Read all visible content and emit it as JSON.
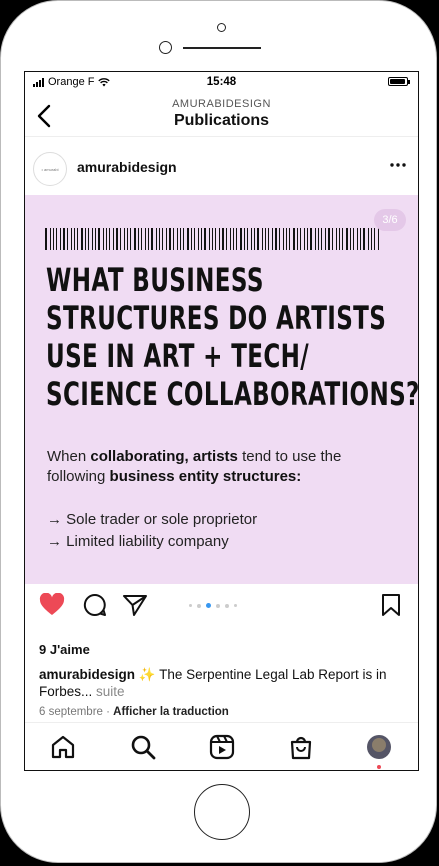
{
  "status": {
    "carrier": "Orange F",
    "time": "15:48"
  },
  "header": {
    "account": "AMURABIDESIGN",
    "title": "Publications"
  },
  "post": {
    "username": "amurabidesign",
    "avatar_text": "• amurabi",
    "counter": "3/6",
    "headline_lines": [
      "WHAT BUSINESS",
      "STRUCTURES DO ARTISTS",
      "USE IN ART + TECH/",
      "SCIENCE COLLABORATIONS?"
    ],
    "intro": {
      "t1": "When ",
      "b1": "collaborating,",
      "t2": " ",
      "b2": "artists",
      "t3": " tend to use the following ",
      "b3": "business entity structures:"
    },
    "list": [
      "→ Sole trader or sole proprietor",
      "→ Limited liability company"
    ],
    "likes": "9 J'aime",
    "caption_user": "amurabidesign",
    "caption_sparkle": "✨",
    "caption_text": " The Serpentine Legal Lab Report is in Forbes... ",
    "caption_more": "suite",
    "date": "6 septembre",
    "separator": " · ",
    "translate": "Afficher la traduction"
  },
  "carousel": {
    "total": 6,
    "active": 3
  },
  "colors": {
    "post_bg": "#f0dcf3",
    "like_red": "#ed4956",
    "dot_active": "#3897f0"
  },
  "icons": [
    "back-icon",
    "more-icon",
    "heart-icon",
    "comment-icon",
    "share-icon",
    "bookmark-icon",
    "home-icon",
    "search-icon",
    "reels-icon",
    "shop-icon",
    "profile-avatar"
  ]
}
